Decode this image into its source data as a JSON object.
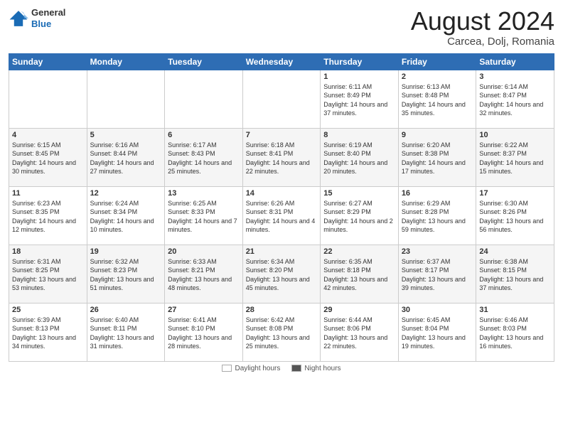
{
  "header": {
    "logo_general": "General",
    "logo_blue": "Blue",
    "month_title": "August 2024",
    "location": "Carcea, Dolj, Romania"
  },
  "calendar": {
    "days_of_week": [
      "Sunday",
      "Monday",
      "Tuesday",
      "Wednesday",
      "Thursday",
      "Friday",
      "Saturday"
    ],
    "weeks": [
      [
        {
          "day": "",
          "info": ""
        },
        {
          "day": "",
          "info": ""
        },
        {
          "day": "",
          "info": ""
        },
        {
          "day": "",
          "info": ""
        },
        {
          "day": "1",
          "sunrise": "6:11 AM",
          "sunset": "8:49 PM",
          "daylight": "14 hours and 37 minutes."
        },
        {
          "day": "2",
          "sunrise": "6:13 AM",
          "sunset": "8:48 PM",
          "daylight": "14 hours and 35 minutes."
        },
        {
          "day": "3",
          "sunrise": "6:14 AM",
          "sunset": "8:47 PM",
          "daylight": "14 hours and 32 minutes."
        }
      ],
      [
        {
          "day": "4",
          "sunrise": "6:15 AM",
          "sunset": "8:45 PM",
          "daylight": "14 hours and 30 minutes."
        },
        {
          "day": "5",
          "sunrise": "6:16 AM",
          "sunset": "8:44 PM",
          "daylight": "14 hours and 27 minutes."
        },
        {
          "day": "6",
          "sunrise": "6:17 AM",
          "sunset": "8:43 PM",
          "daylight": "14 hours and 25 minutes."
        },
        {
          "day": "7",
          "sunrise": "6:18 AM",
          "sunset": "8:41 PM",
          "daylight": "14 hours and 22 minutes."
        },
        {
          "day": "8",
          "sunrise": "6:19 AM",
          "sunset": "8:40 PM",
          "daylight": "14 hours and 20 minutes."
        },
        {
          "day": "9",
          "sunrise": "6:20 AM",
          "sunset": "8:38 PM",
          "daylight": "14 hours and 17 minutes."
        },
        {
          "day": "10",
          "sunrise": "6:22 AM",
          "sunset": "8:37 PM",
          "daylight": "14 hours and 15 minutes."
        }
      ],
      [
        {
          "day": "11",
          "sunrise": "6:23 AM",
          "sunset": "8:35 PM",
          "daylight": "14 hours and 12 minutes."
        },
        {
          "day": "12",
          "sunrise": "6:24 AM",
          "sunset": "8:34 PM",
          "daylight": "14 hours and 10 minutes."
        },
        {
          "day": "13",
          "sunrise": "6:25 AM",
          "sunset": "8:33 PM",
          "daylight": "14 hours and 7 minutes."
        },
        {
          "day": "14",
          "sunrise": "6:26 AM",
          "sunset": "8:31 PM",
          "daylight": "14 hours and 4 minutes."
        },
        {
          "day": "15",
          "sunrise": "6:27 AM",
          "sunset": "8:29 PM",
          "daylight": "14 hours and 2 minutes."
        },
        {
          "day": "16",
          "sunrise": "6:29 AM",
          "sunset": "8:28 PM",
          "daylight": "13 hours and 59 minutes."
        },
        {
          "day": "17",
          "sunrise": "6:30 AM",
          "sunset": "8:26 PM",
          "daylight": "13 hours and 56 minutes."
        }
      ],
      [
        {
          "day": "18",
          "sunrise": "6:31 AM",
          "sunset": "8:25 PM",
          "daylight": "13 hours and 53 minutes."
        },
        {
          "day": "19",
          "sunrise": "6:32 AM",
          "sunset": "8:23 PM",
          "daylight": "13 hours and 51 minutes."
        },
        {
          "day": "20",
          "sunrise": "6:33 AM",
          "sunset": "8:21 PM",
          "daylight": "13 hours and 48 minutes."
        },
        {
          "day": "21",
          "sunrise": "6:34 AM",
          "sunset": "8:20 PM",
          "daylight": "13 hours and 45 minutes."
        },
        {
          "day": "22",
          "sunrise": "6:35 AM",
          "sunset": "8:18 PM",
          "daylight": "13 hours and 42 minutes."
        },
        {
          "day": "23",
          "sunrise": "6:37 AM",
          "sunset": "8:17 PM",
          "daylight": "13 hours and 39 minutes."
        },
        {
          "day": "24",
          "sunrise": "6:38 AM",
          "sunset": "8:15 PM",
          "daylight": "13 hours and 37 minutes."
        }
      ],
      [
        {
          "day": "25",
          "sunrise": "6:39 AM",
          "sunset": "8:13 PM",
          "daylight": "13 hours and 34 minutes."
        },
        {
          "day": "26",
          "sunrise": "6:40 AM",
          "sunset": "8:11 PM",
          "daylight": "13 hours and 31 minutes."
        },
        {
          "day": "27",
          "sunrise": "6:41 AM",
          "sunset": "8:10 PM",
          "daylight": "13 hours and 28 minutes."
        },
        {
          "day": "28",
          "sunrise": "6:42 AM",
          "sunset": "8:08 PM",
          "daylight": "13 hours and 25 minutes."
        },
        {
          "day": "29",
          "sunrise": "6:44 AM",
          "sunset": "8:06 PM",
          "daylight": "13 hours and 22 minutes."
        },
        {
          "day": "30",
          "sunrise": "6:45 AM",
          "sunset": "8:04 PM",
          "daylight": "13 hours and 19 minutes."
        },
        {
          "day": "31",
          "sunrise": "6:46 AM",
          "sunset": "8:03 PM",
          "daylight": "13 hours and 16 minutes."
        }
      ]
    ]
  },
  "footer": {
    "legend": [
      {
        "label": "Daylight hours",
        "color": "#fff"
      },
      {
        "label": "Night hours",
        "color": "#555"
      }
    ]
  }
}
